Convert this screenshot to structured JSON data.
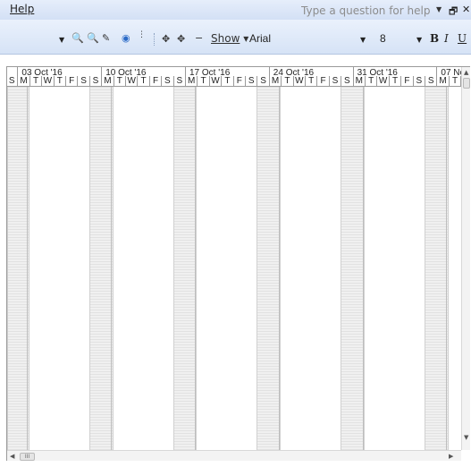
{
  "menubar": {
    "help_label": "Help",
    "ask_placeholder": "Type a question for help"
  },
  "toolbar": {
    "show_label": "Show",
    "font_name": "Arial",
    "font_size": "8",
    "bold_label": "B",
    "italic_label": "I",
    "underline_label": "U"
  },
  "timeline": {
    "weeks": [
      "03 Oct '16",
      "10 Oct '16",
      "17 Oct '16",
      "24 Oct '16",
      "31 Oct '16",
      "07 No"
    ],
    "day_letters": [
      "S",
      "M",
      "T",
      "W",
      "T",
      "F",
      "S"
    ]
  },
  "scrollbar": {
    "thumb_glyph": "III"
  }
}
